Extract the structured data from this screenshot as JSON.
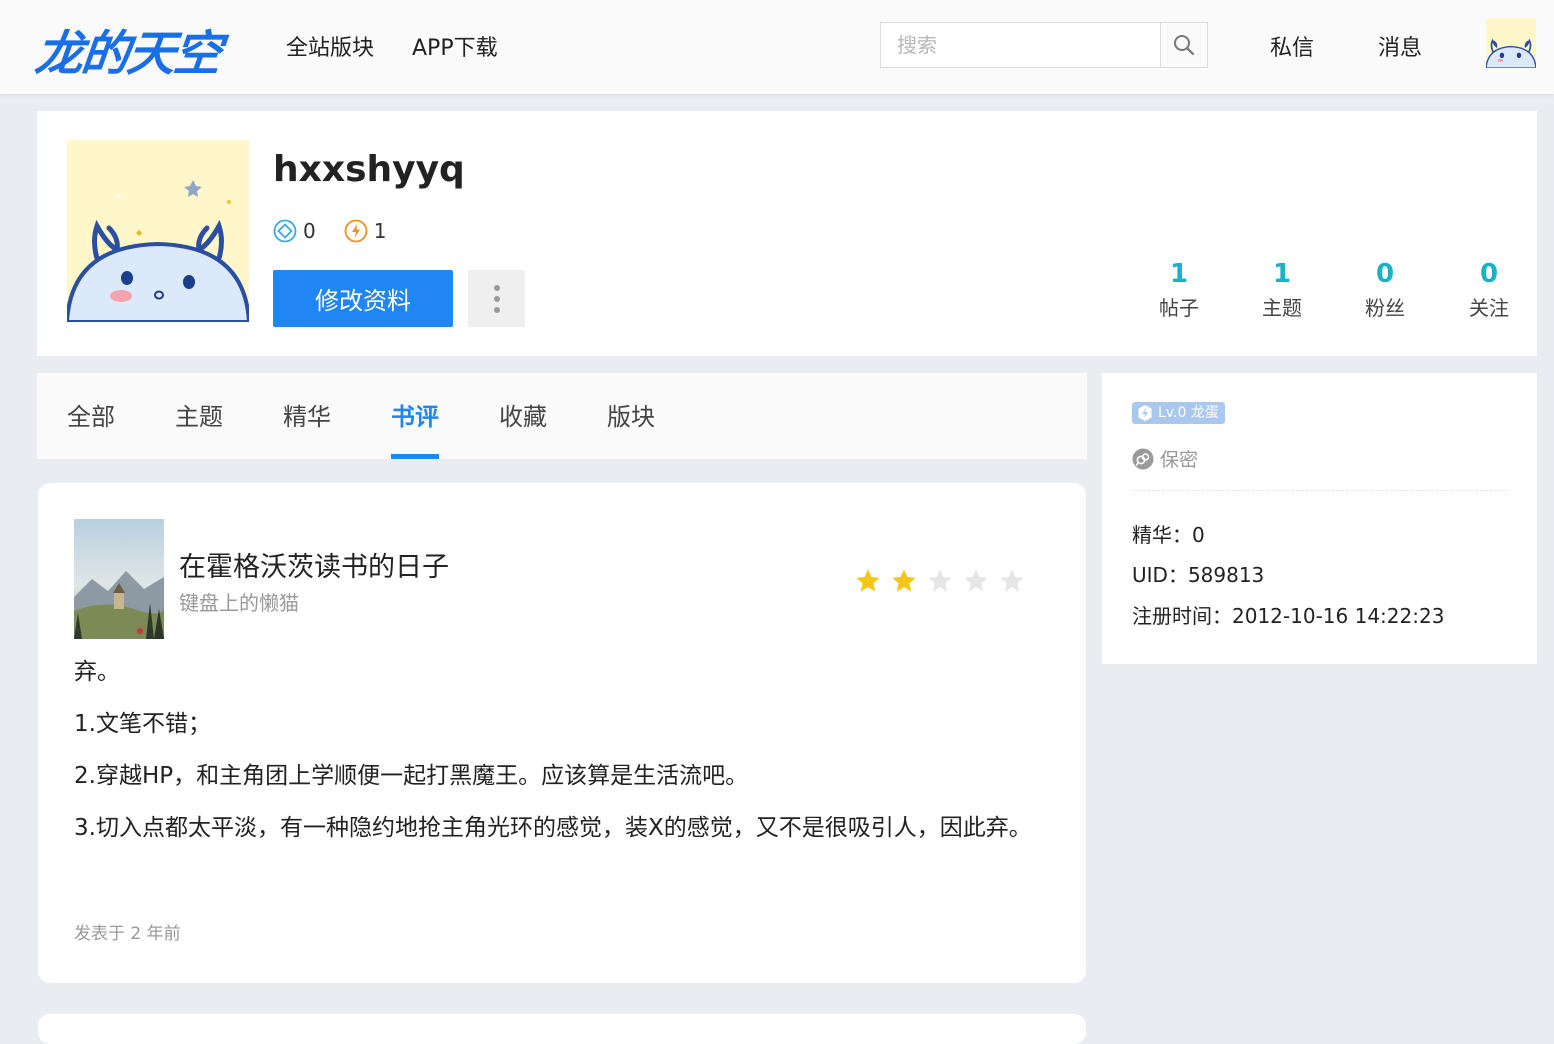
{
  "header": {
    "logo": "龙的天空",
    "nav": {
      "boards": "全站版块",
      "app": "APP下载"
    },
    "search": {
      "placeholder": "搜索",
      "value": ""
    },
    "messages": "私信",
    "notifications": "消息"
  },
  "profile": {
    "username": "hxxshyyq",
    "badge_diamond": "0",
    "badge_flame": "1",
    "edit_label": "修改资料",
    "stats": [
      {
        "num": "1",
        "label": "帖子"
      },
      {
        "num": "1",
        "label": "主题"
      },
      {
        "num": "0",
        "label": "粉丝"
      },
      {
        "num": "0",
        "label": "关注"
      }
    ]
  },
  "tabs": [
    {
      "label": "全部",
      "active": false
    },
    {
      "label": "主题",
      "active": false
    },
    {
      "label": "精华",
      "active": false
    },
    {
      "label": "书评",
      "active": true
    },
    {
      "label": "收藏",
      "active": false
    },
    {
      "label": "版块",
      "active": false
    }
  ],
  "review": {
    "cover_text": "霍格沃茨读书的日子",
    "title": "在霍格沃茨读书的日子",
    "author": "键盘上的懒猫",
    "rating": 2,
    "rating_max": 5,
    "paragraphs": [
      "弃。",
      "1.文笔不错；",
      "2.穿越HP，和主角团上学顺便一起打黑魔王。应该算是生活流吧。",
      "3.切入点都太平淡，有一种隐约地抢主角光环的感觉，装X的感觉，又不是很吸引人，因此弃。"
    ],
    "posted": "发表于 2 年前"
  },
  "side": {
    "level": "Lv.0 龙蛋",
    "gender": "保密",
    "essence_label": "精华：",
    "essence_value": "0",
    "uid_label": "UID：",
    "uid_value": "589813",
    "reg_label": "注册时间：",
    "reg_value": "2012-10-16 14:22:23"
  },
  "colors": {
    "accent": "#1f86f3",
    "stat": "#1ab2c8",
    "star_on": "#f5c518",
    "star_off": "#e6e6e6"
  },
  "icons": {
    "search": "search-icon",
    "diamond": "diamond-icon",
    "flame": "flame-icon",
    "more": "more-vertical-icon",
    "star": "star-icon",
    "level": "lightning-icon",
    "gender": "gender-icon"
  }
}
